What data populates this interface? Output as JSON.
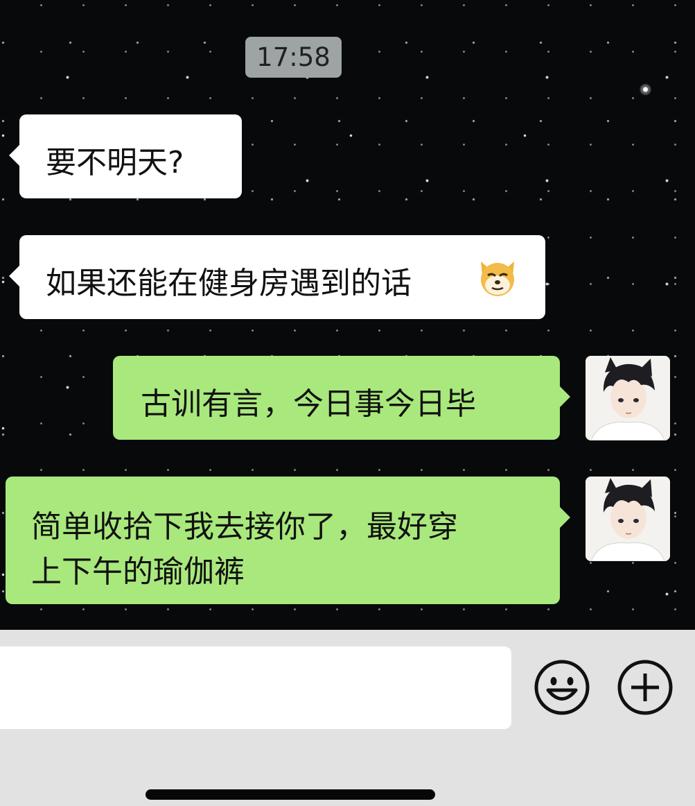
{
  "chat": {
    "timestamp": "17:58",
    "messages": [
      {
        "side": "received",
        "text": "要不明天?"
      },
      {
        "side": "received",
        "text": "如果还能在健身房遇到的话",
        "emoji": "doge-emoji"
      },
      {
        "side": "sent",
        "text": "古训有言，今日事今日毕"
      },
      {
        "side": "sent",
        "lines": [
          "简单收拾下我去接你了，最好穿",
          "上下午的瑜伽裤"
        ]
      }
    ]
  },
  "input_bar": {
    "message_value": "",
    "icons": [
      "smiley-icon",
      "plus-circle-icon"
    ]
  },
  "colors": {
    "sent_bubble": "#a9e87d",
    "received_bubble": "#ffffff",
    "timestamp_pill": "#9ea3a3",
    "input_bar_bg": "#e2e2e2",
    "chat_background": "#07090b"
  }
}
